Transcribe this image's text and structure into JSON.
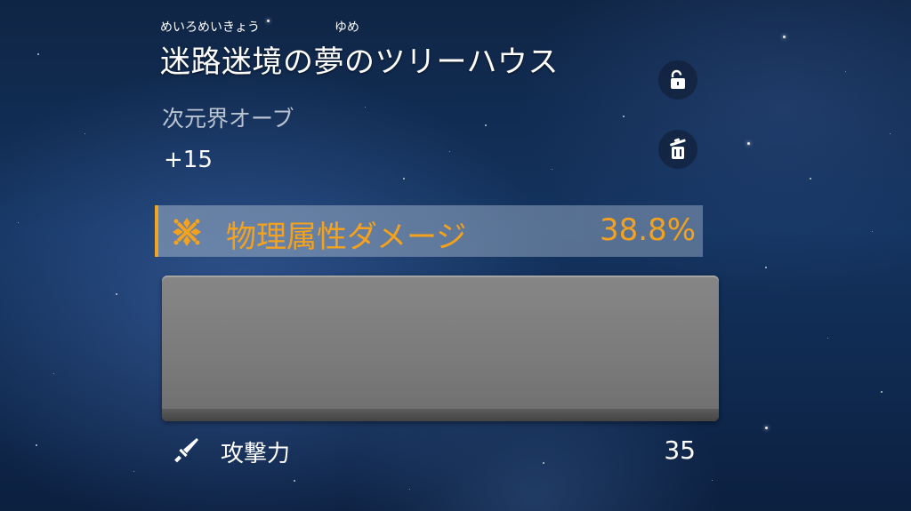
{
  "item": {
    "ruby_1": "めいろめいきょう",
    "ruby_2": "ゆめ",
    "name": "迷路迷境の夢のツリーハウス",
    "type": "次元界オーブ",
    "level": "+15"
  },
  "main_stat": {
    "name": "物理属性ダメージ",
    "value": "38.8%",
    "accent_color": "#f4a21e",
    "icon": "physical-damage-icon"
  },
  "sub_stat": {
    "name": "攻撃力",
    "value": "35",
    "icon": "sword-icon"
  },
  "buttons": {
    "lock_icon": "unlock-icon",
    "discard_icon": "trash-icon"
  }
}
